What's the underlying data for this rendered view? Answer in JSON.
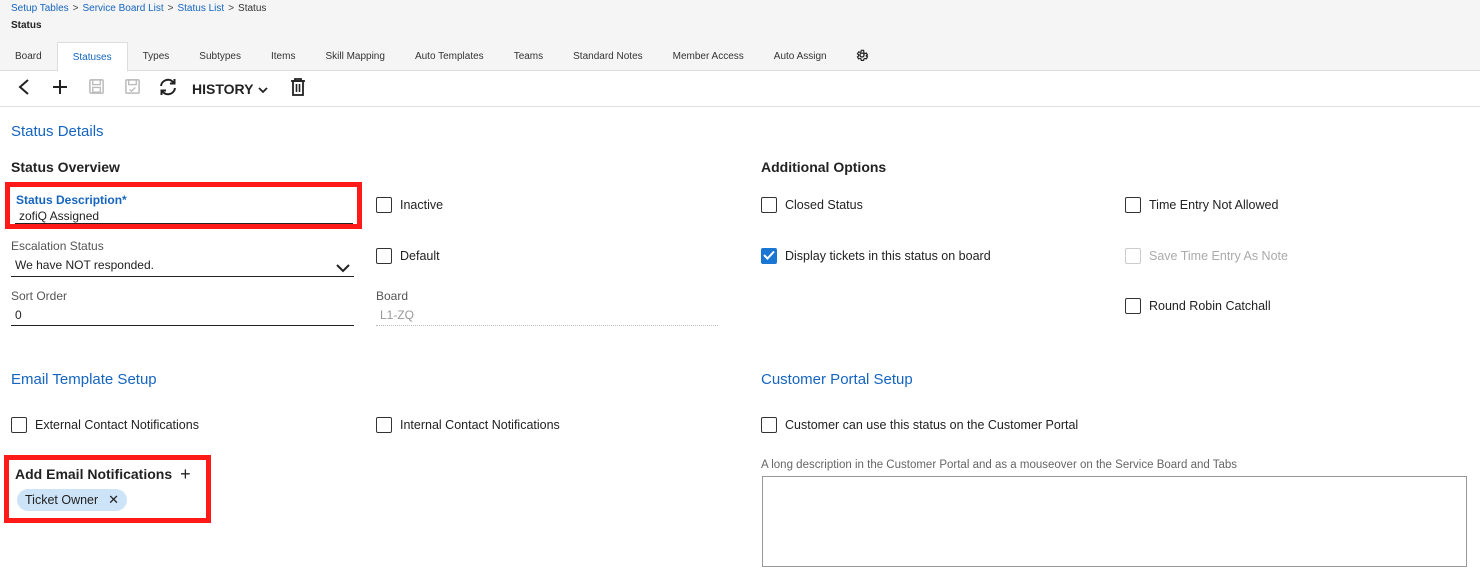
{
  "breadcrumb": {
    "items": [
      "Setup Tables",
      "Service Board List",
      "Status List"
    ],
    "current": "Status",
    "separator": ">"
  },
  "page": {
    "title": "Status"
  },
  "tabs": [
    {
      "label": "Board",
      "active": false
    },
    {
      "label": "Statuses",
      "active": true
    },
    {
      "label": "Types",
      "active": false
    },
    {
      "label": "Subtypes",
      "active": false
    },
    {
      "label": "Items",
      "active": false
    },
    {
      "label": "Skill Mapping",
      "active": false
    },
    {
      "label": "Auto Templates",
      "active": false
    },
    {
      "label": "Teams",
      "active": false
    },
    {
      "label": "Standard Notes",
      "active": false
    },
    {
      "label": "Member Access",
      "active": false
    },
    {
      "label": "Auto Assign",
      "active": false
    }
  ],
  "toolbar": {
    "icons": [
      "back-icon",
      "add-icon",
      "save-icon",
      "save-close-icon",
      "refresh-icon",
      "delete-icon"
    ],
    "history_label": "HISTORY"
  },
  "details": {
    "section_title": "Status Details",
    "overview_title": "Status Overview",
    "status_description_label": "Status Description*",
    "status_description_value": "zofiQ Assigned",
    "escalation_label": "Escalation Status",
    "escalation_value": "We have NOT responded.",
    "sort_order_label": "Sort Order",
    "sort_order_value": "0",
    "board_label": "Board",
    "board_value": "L1-ZQ",
    "inactive_label": "Inactive",
    "inactive_checked": false,
    "default_label": "Default",
    "default_checked": false
  },
  "additional": {
    "title": "Additional Options",
    "closed_status_label": "Closed Status",
    "closed_status_checked": false,
    "display_on_board_label": "Display tickets in this status on board",
    "display_on_board_checked": true,
    "time_entry_not_allowed_label": "Time Entry Not Allowed",
    "time_entry_not_allowed_checked": false,
    "save_time_entry_label": "Save Time Entry As Note",
    "save_time_entry_checked": false,
    "round_robin_label": "Round Robin Catchall",
    "round_robin_checked": false
  },
  "email": {
    "section_title": "Email Template Setup",
    "external_label": "External Contact Notifications",
    "external_checked": false,
    "internal_label": "Internal Contact Notifications",
    "internal_checked": false,
    "add_title": "Add Email Notifications",
    "chips": [
      "Ticket Owner"
    ]
  },
  "portal": {
    "section_title": "Customer Portal Setup",
    "customer_can_use_label": "Customer can use this status on the Customer Portal",
    "customer_can_use_checked": false,
    "description_label": "A long description in the Customer Portal and as a mouseover on the Service Board and Tabs",
    "description_value": ""
  },
  "colors": {
    "accent": "#1565c0",
    "checkbox_checked": "#1976d2",
    "highlight": "#ff1a1a",
    "chip_bg": "#cde3f7"
  }
}
